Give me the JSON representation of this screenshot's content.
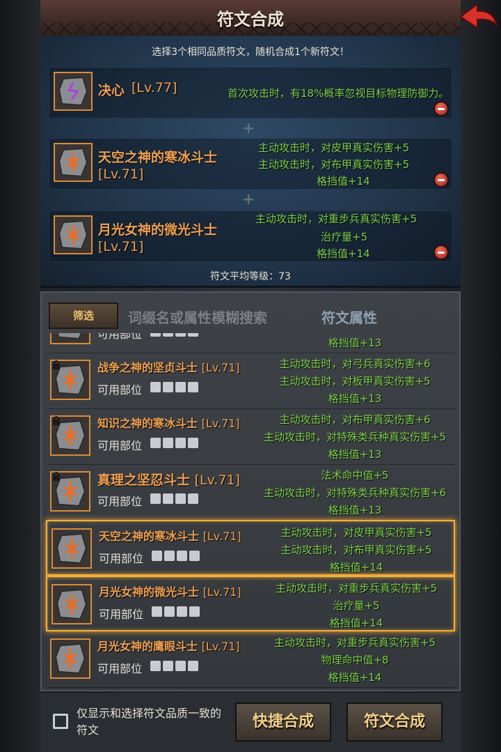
{
  "header": {
    "title": "符文合成"
  },
  "instruction": "选择3个相同品质符文，随机合成1个新符文！",
  "selected": [
    {
      "name": "决心",
      "lv": "[Lv.77]",
      "attrs": [
        "首次攻击时，有18%概率忽视目标物理防御力。"
      ]
    },
    {
      "name": "天空之神的寒冰斗士",
      "lv": "[Lv.71]",
      "attrs": [
        "主动攻击时，对皮甲真实伤害+5",
        "主动攻击时，对布甲真实伤害+5",
        "格挡值+14"
      ]
    },
    {
      "name": "月光女神的微光斗士",
      "lv": "[Lv.71]",
      "attrs": [
        "主动攻击时，对重步兵真实伤害+5",
        "治疗量+5",
        "格挡值+14"
      ]
    }
  ],
  "average": "符文平均等级：73",
  "toolbar": {
    "filter": "筛选",
    "search_placeholder": "词缀名或属性模糊搜索",
    "attr_tab": "符文属性"
  },
  "part_label": "可用部位",
  "list": [
    {
      "name": "",
      "lv": "",
      "locked": false,
      "selected": false,
      "attrs": [
        "",
        "",
        "格挡值+13"
      ]
    },
    {
      "name": "战争之神的坚贞斗士",
      "lv": "[Lv.71]",
      "locked": true,
      "selected": false,
      "attrs": [
        "主动攻击时，对弓兵真实伤害+6",
        "主动攻击时，对板甲真实伤害+5",
        "格挡值+13"
      ]
    },
    {
      "name": "知识之神的寒冰斗士",
      "lv": "[Lv.71]",
      "locked": true,
      "selected": false,
      "attrs": [
        "主动攻击时，对布甲真实伤害+6",
        "主动攻击时，对特殊类兵种真实伤害+5",
        "格挡值+13"
      ]
    },
    {
      "name": "真理之坚忍斗士",
      "lv": "[Lv.71]",
      "locked": true,
      "selected": false,
      "attrs": [
        "法术命中值+5",
        "主动攻击时，对特殊类兵种真实伤害+6",
        "格挡值+13"
      ]
    },
    {
      "name": "天空之神的寒冰斗士",
      "lv": "[Lv.71]",
      "locked": false,
      "selected": true,
      "attrs": [
        "主动攻击时，对皮甲真实伤害+5",
        "主动攻击时，对布甲真实伤害+5",
        "格挡值+14"
      ]
    },
    {
      "name": "月光女神的微光斗士",
      "lv": "[Lv.71]",
      "locked": false,
      "selected": true,
      "attrs": [
        "主动攻击时，对重步兵真实伤害+5",
        "治疗量+5",
        "格挡值+14"
      ]
    },
    {
      "name": "月光女神的鹰眼斗士",
      "lv": "[Lv.71]",
      "locked": false,
      "selected": false,
      "attrs": [
        "主动攻击时，对重步兵真实伤害+5",
        "物理命中值+8",
        "格挡值+14"
      ]
    }
  ],
  "footer": {
    "checkbox_label": "仅显示和选择符文品质一致的符文",
    "quick_button": "快捷合成",
    "compose_button": "符文合成"
  },
  "colors": {
    "name": "#f0a050",
    "attr": "#7ed04a",
    "highlight": "#f2b23a"
  }
}
